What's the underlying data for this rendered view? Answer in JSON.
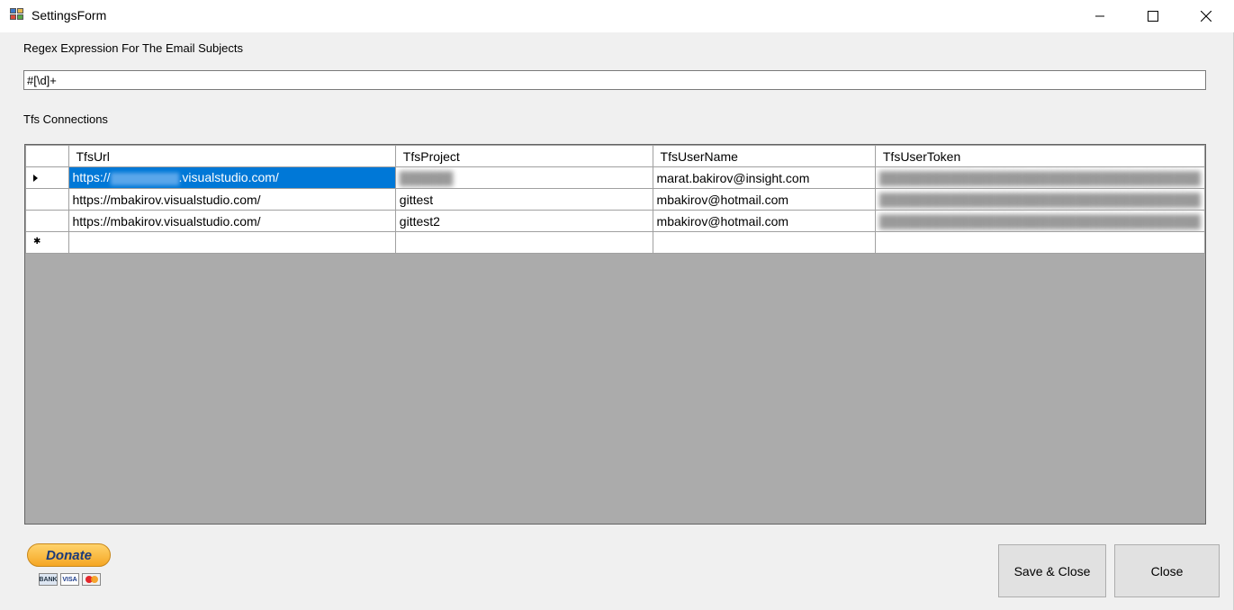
{
  "window": {
    "title": "SettingsForm"
  },
  "regex": {
    "label": "Regex Expression For The Email Subjects",
    "value": "#[\\d]+"
  },
  "tfs": {
    "label": "Tfs Connections",
    "columns": [
      "TfsUrl",
      "TfsProject",
      "TfsUserName",
      "TfsUserToken"
    ],
    "rows": [
      {
        "url_prefix": "https://",
        "url_suffix": ".visualstudio.com/",
        "project": "",
        "username": "marat.bakirov@insight.com",
        "token": ""
      },
      {
        "url": "https://mbakirov.visualstudio.com/",
        "project": "gittest",
        "username": "mbakirov@hotmail.com",
        "token": ""
      },
      {
        "url": "https://mbakirov.visualstudio.com/",
        "project": "gittest2",
        "username": "mbakirov@hotmail.com",
        "token": ""
      }
    ]
  },
  "donate": {
    "label": "Donate",
    "cards": [
      "BANK",
      "VISA"
    ]
  },
  "buttons": {
    "save_close": "Save & Close",
    "close": "Close"
  },
  "colors": {
    "selection": "#0078d7",
    "grid_background": "#ababab",
    "button_face": "#e1e1e1"
  },
  "icons": {
    "app": "form-app-icon",
    "minimize": "minimize-icon",
    "maximize": "maximize-icon",
    "close": "close-icon",
    "current_row": "row-pointer-icon",
    "new_row": "new-row-star-icon"
  }
}
